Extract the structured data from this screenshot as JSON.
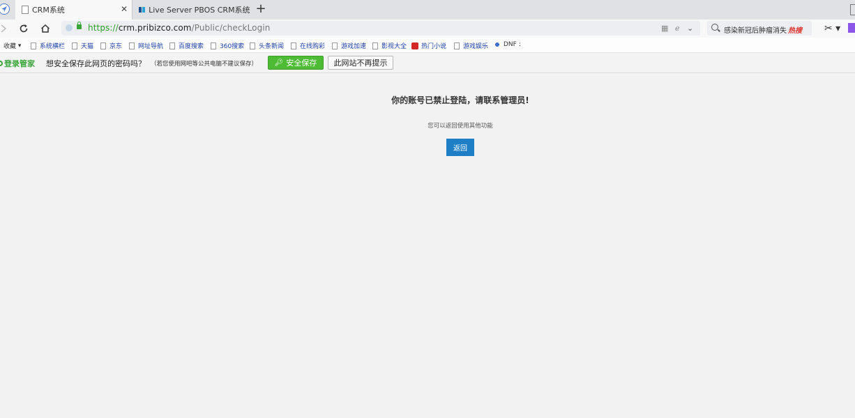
{
  "tabs": [
    {
      "title": "CRM系统",
      "active": true
    },
    {
      "title": "Live Server PBOS CRM系统Re",
      "active": false
    }
  ],
  "address": {
    "scheme": "https://",
    "host": "crm.pribizco.com",
    "path": "/Public/checkLogin"
  },
  "search": {
    "query": "感染新冠后肿瘤消失",
    "badge": "热搜"
  },
  "bookmarks": [
    "收藏",
    "系统横栏",
    "天猫",
    "京东",
    "网址导航",
    "百度搜索",
    "360搜索",
    "头条新闻",
    "在线购彩",
    "游戏加速",
    "影视大全",
    "热门小说",
    "游戏娱乐",
    "DNF :"
  ],
  "password_bar": {
    "brand": "登录管家",
    "question": "想安全保存此网页的密码吗？",
    "note": "（若您使用网吧等公共电脑不建议保存）",
    "save_label": "安全保存",
    "never_label": "此网站不再提示"
  },
  "page": {
    "title": "你的账号已禁止登陆，请联系管理员!",
    "subtitle": "您可以返回使用其他功能",
    "back_label": "返回"
  },
  "colors": {
    "accent_green": "#4dbb34",
    "button_blue": "#1f7fc6",
    "url_green": "#2a9f2a",
    "hot_red": "#e0322c"
  }
}
